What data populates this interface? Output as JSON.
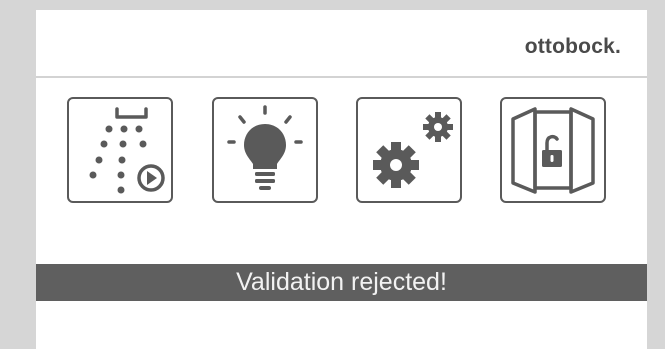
{
  "header": {
    "logo_text": "ottobock."
  },
  "tiles": [
    {
      "name": "shower-program",
      "icon": "shower-play-icon"
    },
    {
      "name": "light",
      "icon": "light-bulb-icon"
    },
    {
      "name": "settings",
      "icon": "gears-icon"
    },
    {
      "name": "door-unlock",
      "icon": "door-unlock-icon"
    }
  ],
  "status": {
    "message": "Validation rejected!"
  },
  "colors": {
    "bezel": "#d6d6d6",
    "icon": "#5a5a5a",
    "status_bar": "#5f5f5f",
    "status_text": "#f2f2f2"
  }
}
